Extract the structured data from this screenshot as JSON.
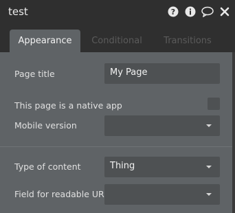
{
  "window": {
    "title": "test",
    "icons": [
      "help-icon",
      "info-icon",
      "comment-icon",
      "close-icon"
    ]
  },
  "tabs": [
    {
      "label": "Appearance",
      "active": true
    },
    {
      "label": "Conditional",
      "active": false
    },
    {
      "label": "Transitions",
      "active": false
    }
  ],
  "form": {
    "page_title": {
      "label": "Page title",
      "value": "My Page"
    },
    "native_app": {
      "label": "This page is a native app",
      "checked": false
    },
    "mobile_version": {
      "label": "Mobile version",
      "value": ""
    },
    "type_of_content": {
      "label": "Type of content",
      "value": "Thing"
    },
    "readable_url": {
      "label": "Field for readable URL",
      "value": ""
    }
  },
  "colors": {
    "header_bg": "#2f2f2f",
    "content_bg": "#5f6366",
    "field_bg": "#4e5153",
    "text": "#e0e0e0",
    "inactive_tab_text": "#5b5b5b"
  }
}
